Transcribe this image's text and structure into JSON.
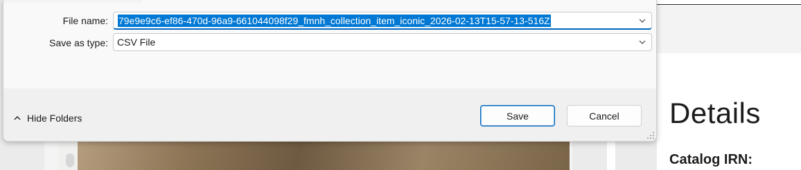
{
  "dialog": {
    "file_name_label": "File name:",
    "file_name_value": "79e9e9c6-ef86-470d-96a9-661044098f29_fmnh_collection_item_iconic_2026-02-13T15-57-13-516Z",
    "save_type_label": "Save as type:",
    "save_type_value": "CSV File",
    "hide_folders_label": "Hide Folders",
    "save_button": "Save",
    "cancel_button": "Cancel"
  },
  "background_page": {
    "details_heading": "Details",
    "catalog_irn_label": "Catalog IRN:"
  },
  "colors": {
    "accent": "#0078d4",
    "focus_border": "#0067c0"
  },
  "icons": {
    "dropdown": "chevron-down-icon",
    "hide_folders": "chevron-up-icon",
    "resize": "resize-grip-icon"
  }
}
